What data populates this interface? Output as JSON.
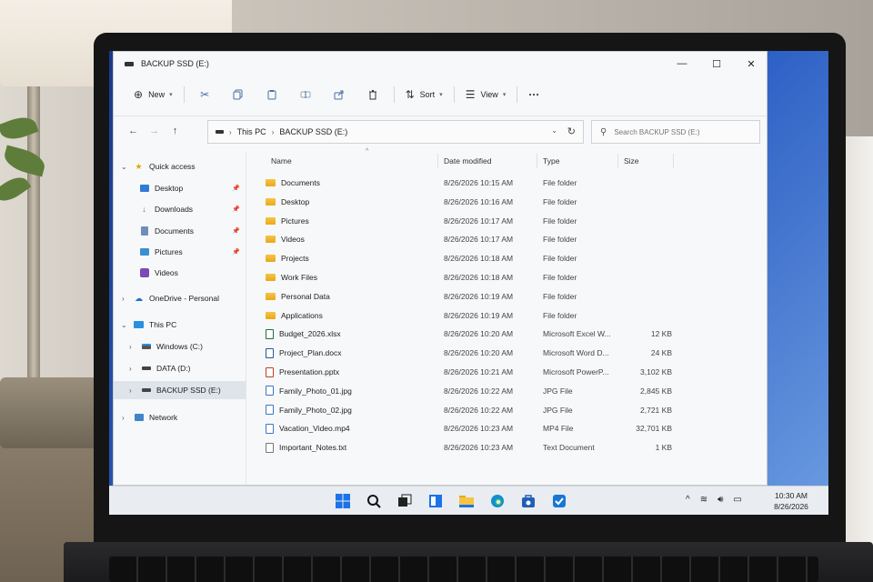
{
  "window": {
    "title": "BACKUP SSD (E:)",
    "controls": {
      "minimize": "—",
      "maximize": "☐",
      "close": "✕"
    }
  },
  "toolbar": {
    "new_label": "New",
    "sort_label": "Sort",
    "view_label": "View",
    "more_label": "···"
  },
  "address": {
    "segments": [
      "This PC",
      "BACKUP SSD (E:)"
    ]
  },
  "search": {
    "placeholder": "Search BACKUP SSD (E:)"
  },
  "sidebar": {
    "quick_access": "Quick access",
    "pinned": [
      {
        "label": "Desktop",
        "icon": "desktop-icon"
      },
      {
        "label": "Downloads",
        "icon": "download-icon"
      },
      {
        "label": "Documents",
        "icon": "documents-icon"
      },
      {
        "label": "Pictures",
        "icon": "pictures-icon"
      },
      {
        "label": "Videos",
        "icon": "videos-icon"
      }
    ],
    "onedrive": "OneDrive - Personal",
    "this_pc": "This PC",
    "drives": [
      {
        "label": "Windows (C:)"
      },
      {
        "label": "DATA (D:)"
      },
      {
        "label": "BACKUP SSD (E:)"
      }
    ],
    "network": "Network"
  },
  "columns": {
    "name": "Name",
    "date": "Date modified",
    "type": "Type",
    "size": "Size"
  },
  "files": [
    {
      "name": "Documents",
      "date": "8/26/2026 10:15 AM",
      "type": "File folder",
      "size": "",
      "icon": "folder"
    },
    {
      "name": "Desktop",
      "date": "8/26/2026 10:16 AM",
      "type": "File folder",
      "size": "",
      "icon": "folder"
    },
    {
      "name": "Pictures",
      "date": "8/26/2026 10:17 AM",
      "type": "File folder",
      "size": "",
      "icon": "folder"
    },
    {
      "name": "Videos",
      "date": "8/26/2026 10:17 AM",
      "type": "File folder",
      "size": "",
      "icon": "folder"
    },
    {
      "name": "Projects",
      "date": "8/26/2026 10:18 AM",
      "type": "File folder",
      "size": "",
      "icon": "folder"
    },
    {
      "name": "Work Files",
      "date": "8/26/2026 10:18 AM",
      "type": "File folder",
      "size": "",
      "icon": "folder"
    },
    {
      "name": "Personal Data",
      "date": "8/26/2026 10:19 AM",
      "type": "File folder",
      "size": "",
      "icon": "folder"
    },
    {
      "name": "Applications",
      "date": "8/26/2026 10:19 AM",
      "type": "File folder",
      "size": "",
      "icon": "folder"
    },
    {
      "name": "Budget_2026.xlsx",
      "date": "8/26/2026 10:20 AM",
      "type": "Microsoft Excel W...",
      "size": "12 KB",
      "icon": "excel"
    },
    {
      "name": "Project_Plan.docx",
      "date": "8/26/2026 10:20 AM",
      "type": "Microsoft Word D...",
      "size": "24 KB",
      "icon": "word"
    },
    {
      "name": "Presentation.pptx",
      "date": "8/26/2026 10:21 AM",
      "type": "Microsoft PowerP...",
      "size": "3,102 KB",
      "icon": "powerpoint"
    },
    {
      "name": "Family_Photo_01.jpg",
      "date": "8/26/2026 10:22 AM",
      "type": "JPG File",
      "size": "2,845 KB",
      "icon": "image"
    },
    {
      "name": "Family_Photo_02.jpg",
      "date": "8/26/2026 10:22 AM",
      "type": "JPG File",
      "size": "2,721 KB",
      "icon": "image"
    },
    {
      "name": "Vacation_Video.mp4",
      "date": "8/26/2026 10:23 AM",
      "type": "MP4 File",
      "size": "32,701 KB",
      "icon": "video"
    },
    {
      "name": "Important_Notes.txt",
      "date": "8/26/2026 10:23 AM",
      "type": "Text Document",
      "size": "1 KB",
      "icon": "text"
    }
  ],
  "icon_colors": {
    "folder": "#f0b429",
    "excel": "#1d6f42",
    "word": "#2b579a",
    "powerpoint": "#c43e1c",
    "image": "#3a78c2",
    "video": "#3a78c2",
    "text": "#777777"
  },
  "taskbar": {
    "apps": [
      "start-icon",
      "search-icon",
      "task-view-icon",
      "widgets-icon",
      "file-explorer-icon",
      "edge-icon",
      "store-icon",
      "outlook-icon"
    ],
    "time": "10:30 AM",
    "date": "8/26/2026"
  }
}
